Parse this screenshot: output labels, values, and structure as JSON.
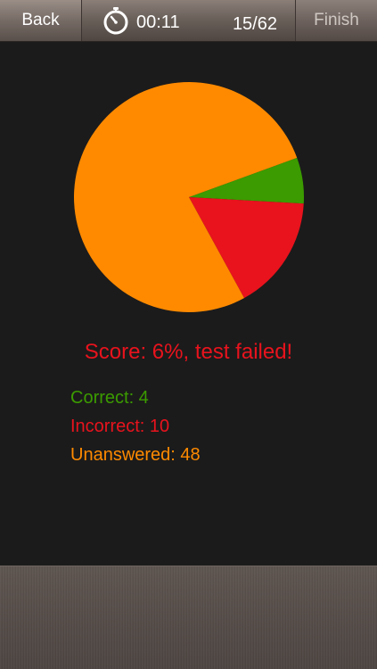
{
  "header": {
    "back_label": "Back",
    "timer": "00:11",
    "progress": "15/62",
    "finish_label": "Finish"
  },
  "result": {
    "score_text": "Score: 6%, test failed!",
    "correct_text": "Correct: 4",
    "incorrect_text": "Incorrect: 10",
    "unanswered_text": "Unanswered: 48"
  },
  "colors": {
    "correct": "#3b9b00",
    "incorrect": "#e8131d",
    "unanswered": "#ff8a00",
    "background": "#1b1b1b"
  },
  "chart_data": {
    "type": "pie",
    "categories": [
      "Correct",
      "Incorrect",
      "Unanswered"
    ],
    "values": [
      4,
      10,
      48
    ],
    "colors": [
      "#3b9b00",
      "#e8131d",
      "#ff8a00"
    ]
  }
}
